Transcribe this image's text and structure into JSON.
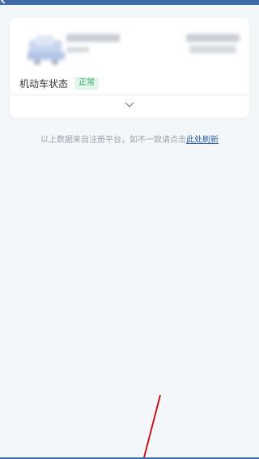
{
  "header": {
    "back_icon": "back-arrow-icon",
    "bar_color": "#3b6aa6"
  },
  "vehicle_card": {
    "thumbnail_icon": "vehicle-thumbnail-icon",
    "status_label": "机动车状态",
    "status_value": "正常",
    "status_color": "#35a864",
    "expand_icon": "chevron-down-icon"
  },
  "notice": {
    "text": "以上数据来自注册平台，如不一致请点击",
    "link_label": "此处刷新"
  }
}
